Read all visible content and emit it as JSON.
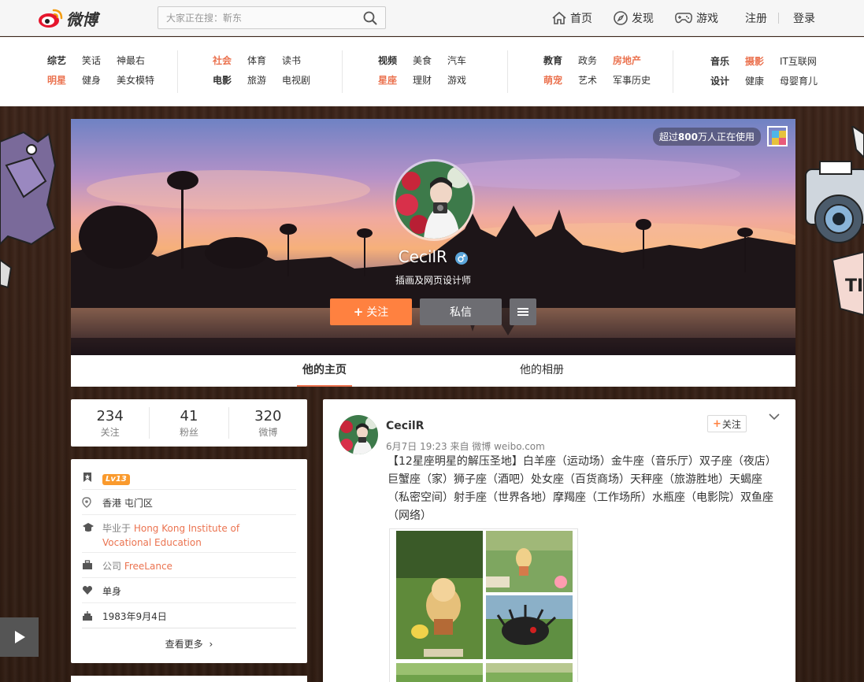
{
  "brand": {
    "name": "微博"
  },
  "search": {
    "placeholder": "大家正在搜：靳东"
  },
  "topnav": [
    {
      "label": "首页",
      "icon": "home-icon"
    },
    {
      "label": "发现",
      "icon": "compass-icon"
    },
    {
      "label": "游戏",
      "icon": "gamepad-icon"
    },
    {
      "label": "注册"
    },
    {
      "label": "登录"
    }
  ],
  "categories": {
    "group1": {
      "row1": [
        "综艺",
        "笑话",
        "神最右"
      ],
      "row2": [
        "明星",
        "健身",
        "美女模特"
      ]
    },
    "group2": {
      "row1": [
        "社会",
        "体育",
        "读书"
      ],
      "row2": [
        "电影",
        "旅游",
        "电视剧"
      ]
    },
    "group3": {
      "row1": [
        "视频",
        "美食",
        "汽车"
      ],
      "row2": [
        "星座",
        "理财",
        "游戏"
      ]
    },
    "group4": {
      "row1": [
        "教育",
        "政务",
        "房地产"
      ],
      "row2": [
        "萌宠",
        "艺术",
        "军事历史"
      ]
    },
    "group5": {
      "row1": [
        "音乐",
        "摄影",
        "IT互联网"
      ],
      "row2": [
        "设计",
        "健康",
        "母婴育儿"
      ]
    }
  },
  "cover": {
    "badge_prefix": "超过",
    "badge_bold": "800",
    "badge_suffix": "万人正在使用"
  },
  "profile": {
    "name": "CecilR",
    "description": "插画及网页设计师",
    "follow_button": "关注",
    "message_button": "私信"
  },
  "tabs": [
    {
      "label": "他的主页",
      "active": true
    },
    {
      "label": "他的相册",
      "active": false
    }
  ],
  "stats": [
    {
      "value": "234",
      "label": "关注"
    },
    {
      "value": "41",
      "label": "粉丝"
    },
    {
      "value": "320",
      "label": "微博"
    }
  ],
  "info": {
    "level": "Lv13",
    "location": "香港 屯门区",
    "education_prefix": "毕业于 ",
    "education_link": "Hong Kong Institute of Vocational Education",
    "company_prefix": "公司 ",
    "company_link": "FreeLance",
    "relationship": "单身",
    "birthday": "1983年9月4日",
    "see_more": "查看更多"
  },
  "post": {
    "author": "CecilR",
    "meta": "6月7日 19:23 来自 微博 weibo.com",
    "follow_label": "关注",
    "text": "【12星座明星的解压圣地】白羊座（运动场）金牛座（音乐厅）双子座（夜店）巨蟹座（家）狮子座（酒吧）处女座（百货商场）天秤座（旅游胜地）天蝎座（私密空间）射手座（世界各地）摩羯座（工作场所）水瓶座（电影院）双鱼座（网络）"
  },
  "colors": {
    "accent": "#eb7350",
    "follow_btn": "#ff8140",
    "gender": "#5aa5da",
    "level_badge": "#fa9a2d"
  }
}
